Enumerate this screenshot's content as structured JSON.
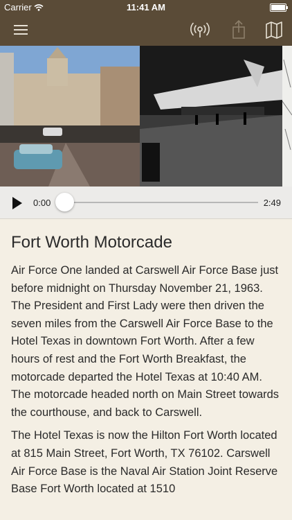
{
  "status_bar": {
    "carrier": "Carrier",
    "time": "11:41 AM"
  },
  "navbar": {
    "menu_icon": "hamburger-icon",
    "beacon_icon": "radio-waves-icon",
    "share_icon": "share-icon",
    "map_icon": "map-icon"
  },
  "photos": [
    "motorcade-street-photo",
    "air-force-one-night-photo",
    "map-clipping-photo"
  ],
  "player": {
    "current_time": "0:00",
    "duration": "2:49",
    "progress": 0.0
  },
  "article": {
    "title": "Fort Worth Motorcade",
    "paragraphs": [
      "Air Force One landed at Carswell Air Force Base just before midnight on Thursday November 21, 1963. The President and First Lady were then driven the seven miles from the Carswell Air Force Base to the Hotel Texas in downtown Fort Worth. After a few hours of rest and the Fort Worth Breakfast, the motorcade departed the Hotel Texas at 10:40 AM. The motorcade headed north on Main Street towards the courthouse, and back to Carswell.",
      "The Hotel Texas is now the Hilton Fort Worth located at 815 Main Street, Fort Worth, TX 76102. Carswell Air Force Base is the Naval Air Station Joint Reserve Base Fort Worth located at 1510"
    ]
  },
  "colors": {
    "navbar": "#5a4b37",
    "background": "#f4efe4",
    "player_bg": "#ecebe9"
  }
}
